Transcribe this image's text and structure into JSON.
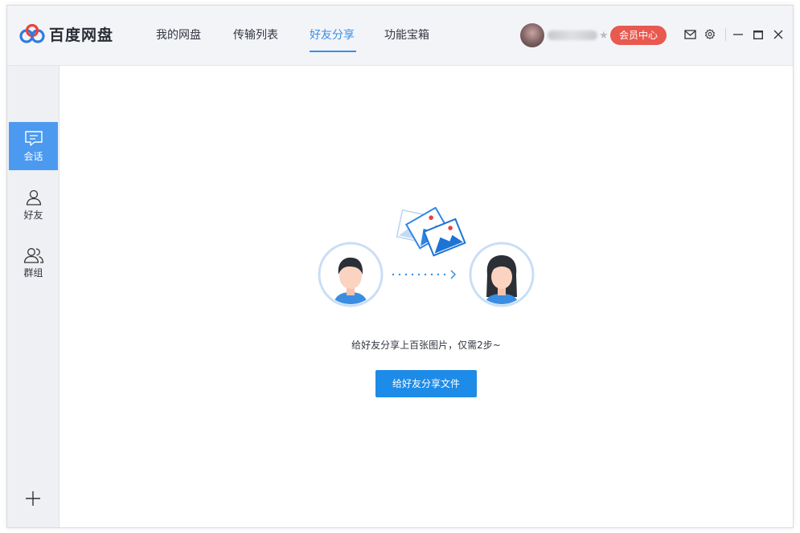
{
  "app": {
    "name": "百度网盘"
  },
  "nav": {
    "tabs": [
      {
        "label": "我的网盘"
      },
      {
        "label": "传输列表"
      },
      {
        "label": "好友分享",
        "active": true
      },
      {
        "label": "功能宝箱"
      }
    ]
  },
  "header": {
    "vip_label": "会员中心",
    "icons": [
      "mail-icon",
      "settings-icon",
      "minimize-icon",
      "maximize-icon",
      "close-icon"
    ]
  },
  "sidebar": {
    "items": [
      {
        "label": "会话",
        "icon": "chat-icon",
        "active": true
      },
      {
        "label": "好友",
        "icon": "person-icon"
      },
      {
        "label": "群组",
        "icon": "group-icon"
      }
    ],
    "add_icon": "plus-icon"
  },
  "main": {
    "empty_text": "给好友分享上百张图片，仅需2步~",
    "share_button": "给好友分享文件"
  },
  "colors": {
    "accent": "#3a8ee6",
    "primary_button": "#1d8be8",
    "vip": "#e8594f",
    "sidebar_active": "#4b9af0"
  }
}
